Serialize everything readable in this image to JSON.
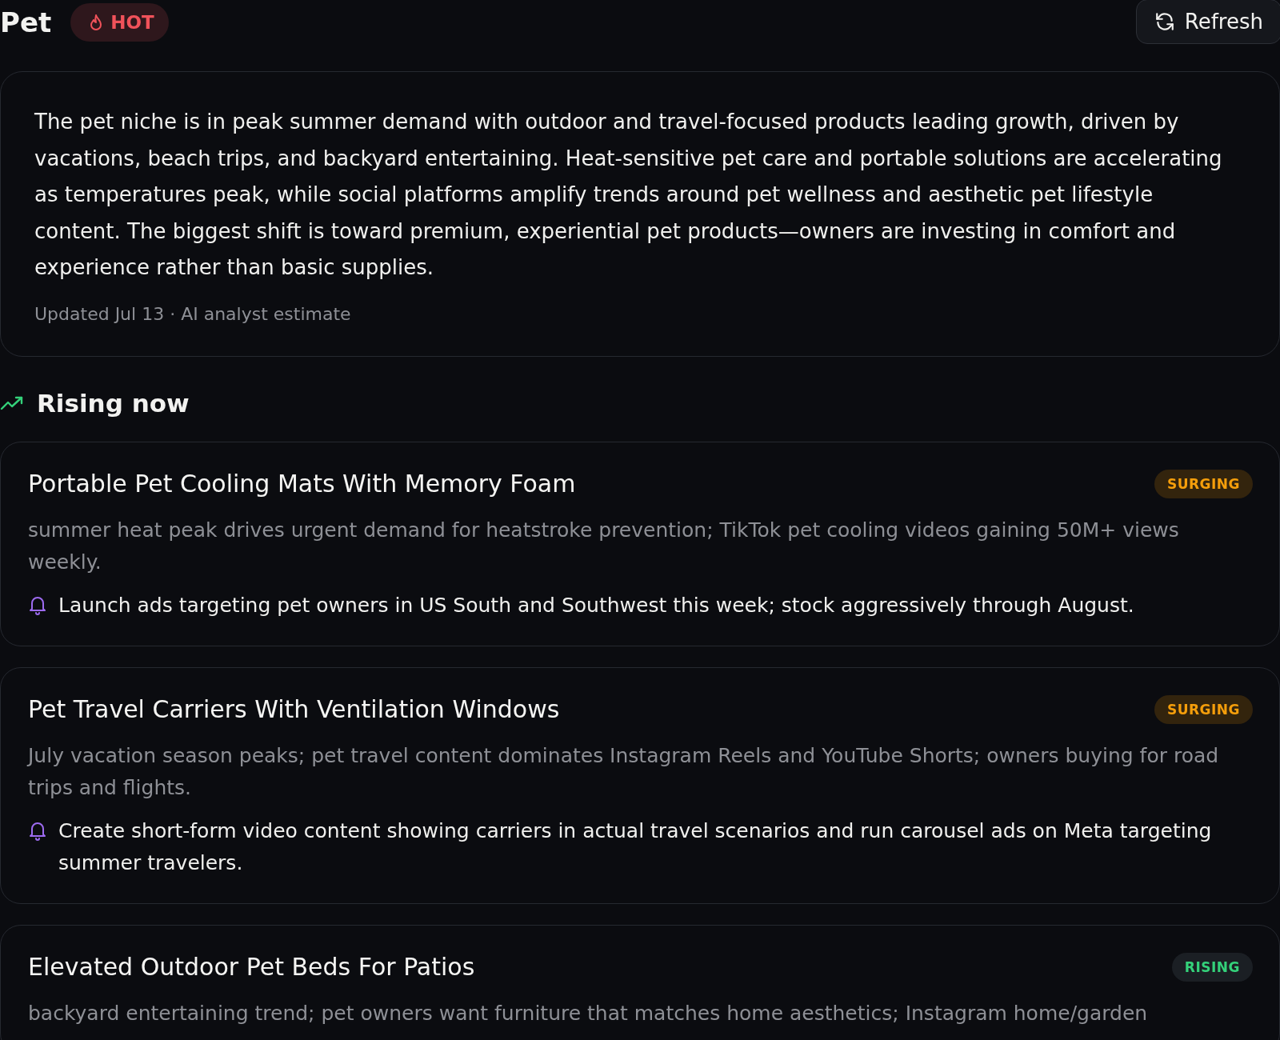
{
  "header": {
    "title": "Pet",
    "badge": {
      "label": "HOT",
      "kind": "hot"
    },
    "refresh_button": "Refresh"
  },
  "summary": {
    "text": "The pet niche is in peak summer demand with outdoor and travel-focused products leading growth, driven by vacations, beach trips, and backyard entertaining. Heat-sensitive pet care and portable solutions are accelerating as temperatures peak, while social platforms amplify trends around pet wellness and aesthetic pet lifestyle content. The biggest shift is toward premium, experiential pet products—owners are investing in comfort and experience rather than basic supplies.",
    "meta": "Updated Jul 13 · AI analyst estimate"
  },
  "section": {
    "title": "Rising now"
  },
  "trends": [
    {
      "title": "Portable Pet Cooling Mats With Memory Foam",
      "status": {
        "label": "SURGING",
        "kind": "surging"
      },
      "description": "summer heat peak drives urgent demand for heatstroke prevention; TikTok pet cooling videos gaining 50M+ views weekly.",
      "action": "Launch ads targeting pet owners in US South and Southwest this week; stock aggressively through August."
    },
    {
      "title": "Pet Travel Carriers With Ventilation Windows",
      "status": {
        "label": "SURGING",
        "kind": "surging"
      },
      "description": "July vacation season peaks; pet travel content dominates Instagram Reels and YouTube Shorts; owners buying for road trips and flights.",
      "action": "Create short-form video content showing carriers in actual travel scenarios and run carousel ads on Meta targeting summer travelers."
    },
    {
      "title": "Elevated Outdoor Pet Beds For Patios",
      "status": {
        "label": "RISING",
        "kind": "rising"
      },
      "description": "backyard entertaining trend; pet owners want furniture that matches home aesthetics; Instagram home/garden"
    }
  ]
}
